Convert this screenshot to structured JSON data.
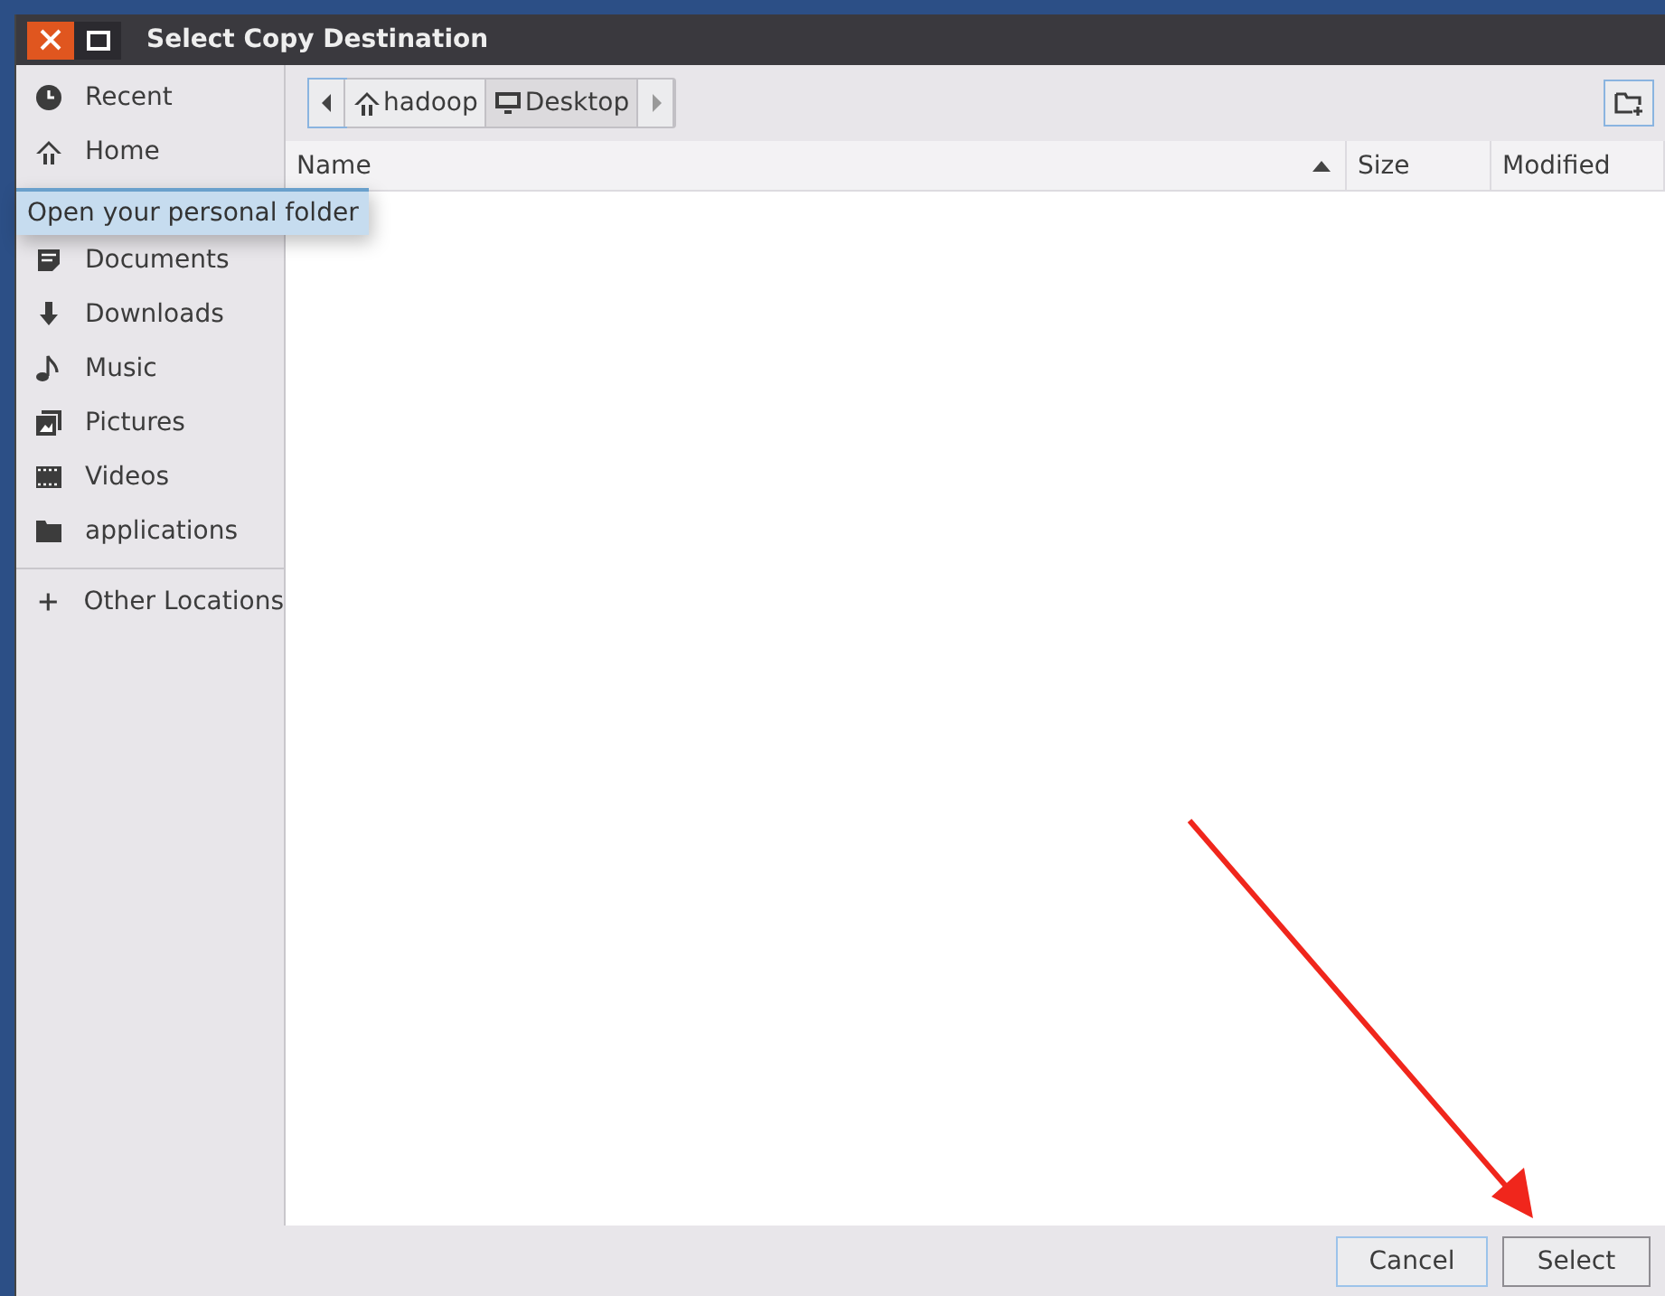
{
  "window": {
    "title": "Select Copy Destination"
  },
  "sidebar": {
    "items": [
      {
        "label": "Recent",
        "kind": "recent"
      },
      {
        "label": "Home",
        "kind": "home"
      },
      {
        "label": "Documents",
        "kind": "documents"
      },
      {
        "label": "Downloads",
        "kind": "downloads"
      },
      {
        "label": "Music",
        "kind": "music"
      },
      {
        "label": "Pictures",
        "kind": "pictures"
      },
      {
        "label": "Videos",
        "kind": "videos"
      },
      {
        "label": "applications",
        "kind": "folder"
      }
    ],
    "other": {
      "label": "Other Locations"
    }
  },
  "tooltip": "Open your personal folder",
  "path_bar": [
    {
      "label": "hadoop",
      "kind": "home",
      "selected": false
    },
    {
      "label": "Desktop",
      "kind": "desktop",
      "selected": true
    }
  ],
  "table": {
    "columns": [
      {
        "label": "Name",
        "sorted": true
      },
      {
        "label": "Size",
        "sorted": false
      },
      {
        "label": "Modified",
        "sorted": false
      }
    ]
  },
  "buttons": [
    {
      "label": "Cancel",
      "default": false
    },
    {
      "label": "Select",
      "default": true
    }
  ]
}
